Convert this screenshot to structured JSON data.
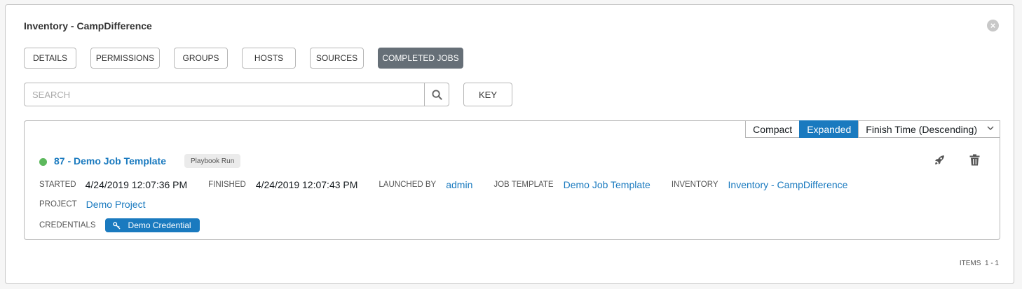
{
  "panel": {
    "title": "Inventory - CampDifference",
    "close_icon": "close-circle-icon"
  },
  "tabs": [
    {
      "label": "DETAILS",
      "active": false
    },
    {
      "label": "PERMISSIONS",
      "active": false
    },
    {
      "label": "GROUPS",
      "active": false
    },
    {
      "label": "HOSTS",
      "active": false
    },
    {
      "label": "SOURCES",
      "active": false
    },
    {
      "label": "COMPLETED JOBS",
      "active": true
    }
  ],
  "search": {
    "placeholder": "SEARCH",
    "value": "",
    "icon": "search-icon",
    "key_label": "KEY"
  },
  "toolbar": {
    "compact_label": "Compact",
    "expanded_label": "Expanded",
    "expanded_active": true,
    "sort_label": "Finish Time (Descending)"
  },
  "job": {
    "status": "successful",
    "status_color": "#5cb85c",
    "title": "87 - Demo Job Template",
    "type": "Playbook Run",
    "started_label": "STARTED",
    "started_value": "4/24/2019 12:07:36 PM",
    "finished_label": "FINISHED",
    "finished_value": "4/24/2019 12:07:43 PM",
    "launched_by_label": "LAUNCHED BY",
    "launched_by_value": "admin",
    "job_template_label": "JOB TEMPLATE",
    "job_template_value": "Demo Job Template",
    "inventory_label": "INVENTORY",
    "inventory_value": "Inventory - CampDifference",
    "project_label": "PROJECT",
    "project_value": "Demo Project",
    "credentials_label": "CREDENTIALS",
    "credential_value": "Demo Credential",
    "relaunch_icon": "rocket-icon",
    "delete_icon": "trash-icon"
  },
  "pagination": {
    "label": "ITEMS",
    "range": "1 - 1"
  },
  "colors": {
    "accent": "#1a7abf",
    "active_tab": "#666f77",
    "success": "#5cb85c"
  }
}
